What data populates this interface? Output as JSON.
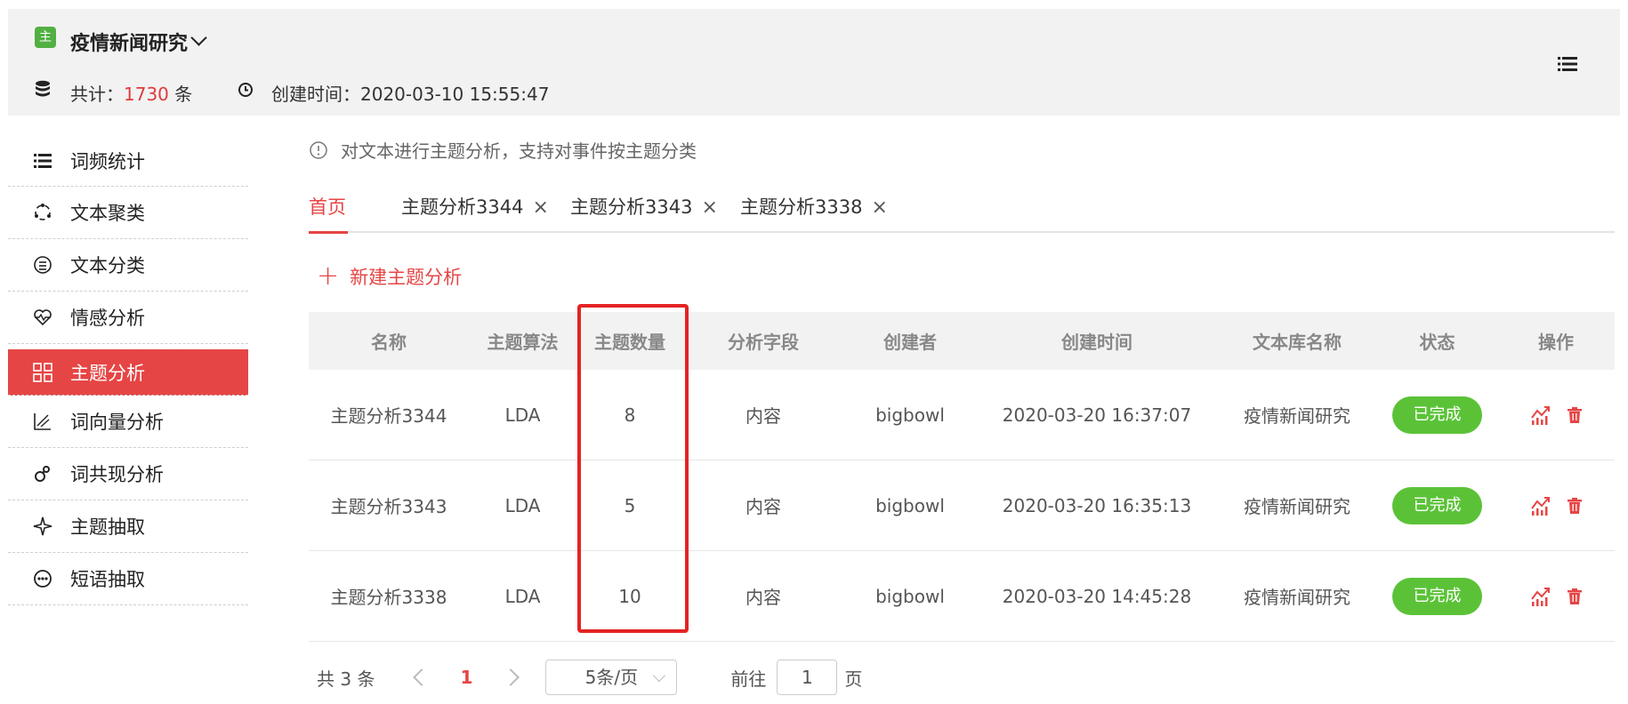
{
  "header": {
    "badge": "主",
    "project_name": "疫情新闻研究",
    "count_label": "共计：",
    "count_value": "1730",
    "count_unit": " 条",
    "created_label": "创建时间：",
    "created_value": "2020-03-10 15:55:47"
  },
  "sidebar": {
    "items": [
      {
        "label": "词频统计",
        "icon": "list-icon"
      },
      {
        "label": "文本聚类",
        "icon": "cluster-icon"
      },
      {
        "label": "文本分类",
        "icon": "classify-icon"
      },
      {
        "label": "情感分析",
        "icon": "heart-pulse-icon"
      },
      {
        "label": "主题分析",
        "icon": "grid-icon"
      },
      {
        "label": "词向量分析",
        "icon": "vector-icon"
      },
      {
        "label": "词共现分析",
        "icon": "cooccurrence-icon"
      },
      {
        "label": "主题抽取",
        "icon": "sparkle-icon"
      },
      {
        "label": "短语抽取",
        "icon": "chat-face-icon"
      }
    ],
    "active_index": 4
  },
  "tip": "对文本进行主题分析，支持对事件按主题分类",
  "tabs": [
    {
      "label": "首页",
      "closable": false
    },
    {
      "label": "主题分析3344",
      "closable": true
    },
    {
      "label": "主题分析3343",
      "closable": true
    },
    {
      "label": "主题分析3338",
      "closable": true
    }
  ],
  "close_symbol": "×",
  "new_button": {
    "plus": "+",
    "label": "新建主题分析"
  },
  "table": {
    "columns": [
      "名称",
      "主题算法",
      "主题数量",
      "分析字段",
      "创建者",
      "创建时间",
      "文本库名称",
      "状态",
      "操作"
    ],
    "rows": [
      [
        "主题分析3344",
        "LDA",
        "8",
        "内容",
        "bigbowl",
        "2020-03-20 16:37:07",
        "疫情新闻研究",
        "已完成"
      ],
      [
        "主题分析3343",
        "LDA",
        "5",
        "内容",
        "bigbowl",
        "2020-03-20 16:35:13",
        "疫情新闻研究",
        "已完成"
      ],
      [
        "主题分析3338",
        "LDA",
        "10",
        "内容",
        "bigbowl",
        "2020-03-20 14:45:28",
        "疫情新闻研究",
        "已完成"
      ]
    ]
  },
  "pager": {
    "total": "共 3 条",
    "current": "1",
    "page_size": "5条/页",
    "goto_label": "前往",
    "goto_value": "1",
    "goto_unit": "页"
  },
  "colors": {
    "accent": "#e64545",
    "success": "#5bc238",
    "highlight": "#e42323"
  }
}
